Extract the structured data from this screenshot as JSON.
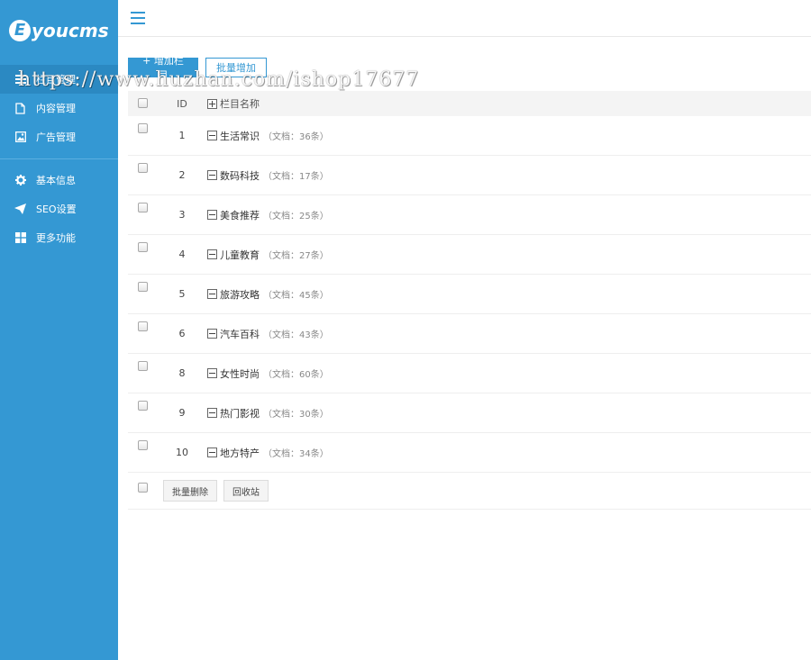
{
  "brand": {
    "logo_letter": "E",
    "logo_text": "youcms",
    "accent_color": "#3498d3"
  },
  "sidebar": {
    "groups": [
      [
        {
          "label": "栏目管理",
          "icon": "list-icon",
          "active": true
        },
        {
          "label": "内容管理",
          "icon": "file-icon",
          "active": false
        },
        {
          "label": "广告管理",
          "icon": "image-icon",
          "active": false
        }
      ],
      [
        {
          "label": "基本信息",
          "icon": "gear-icon",
          "active": false
        },
        {
          "label": "SEO设置",
          "icon": "send-icon",
          "active": false
        },
        {
          "label": "更多功能",
          "icon": "grid-icon",
          "active": false
        }
      ]
    ]
  },
  "toolbar": {
    "add_label": "+ 增加栏目",
    "batch_add_label": "批量增加"
  },
  "table": {
    "headers": {
      "id": "ID",
      "name": "栏目名称"
    },
    "rows": [
      {
        "id": "1",
        "name": "生活常识",
        "docs": "（文档：36条）"
      },
      {
        "id": "2",
        "name": "数码科技",
        "docs": "（文档：17条）"
      },
      {
        "id": "3",
        "name": "美食推荐",
        "docs": "（文档：25条）"
      },
      {
        "id": "4",
        "name": "儿童教育",
        "docs": "（文档：27条）"
      },
      {
        "id": "5",
        "name": "旅游攻略",
        "docs": "（文档：45条）"
      },
      {
        "id": "6",
        "name": "汽车百科",
        "docs": "（文档：43条）"
      },
      {
        "id": "8",
        "name": "女性时尚",
        "docs": "（文档：60条）"
      },
      {
        "id": "9",
        "name": "热门影视",
        "docs": "（文档：30条）"
      },
      {
        "id": "10",
        "name": "地方特产",
        "docs": "（文档：34条）"
      }
    ]
  },
  "footer": {
    "batch_delete_label": "批量删除",
    "recycle_label": "回收站"
  },
  "watermark": "https://www.huzhan.com/ishop17677"
}
